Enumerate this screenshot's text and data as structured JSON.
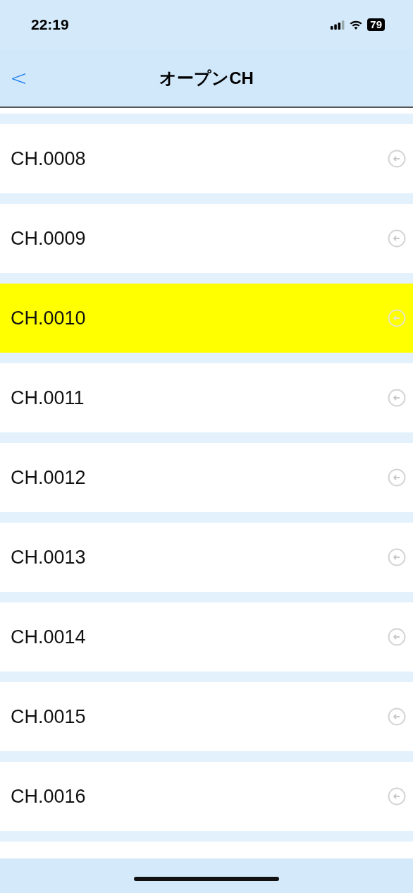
{
  "status_bar": {
    "time": "22:19",
    "battery": "79"
  },
  "nav": {
    "back": "<",
    "title": "オープンCH"
  },
  "channels": [
    {
      "label": "CH.0008",
      "selected": false
    },
    {
      "label": "CH.0009",
      "selected": false
    },
    {
      "label": "CH.0010",
      "selected": true
    },
    {
      "label": "CH.0011",
      "selected": false
    },
    {
      "label": "CH.0012",
      "selected": false
    },
    {
      "label": "CH.0013",
      "selected": false
    },
    {
      "label": "CH.0014",
      "selected": false
    },
    {
      "label": "CH.0015",
      "selected": false
    },
    {
      "label": "CH.0016",
      "selected": false
    }
  ]
}
